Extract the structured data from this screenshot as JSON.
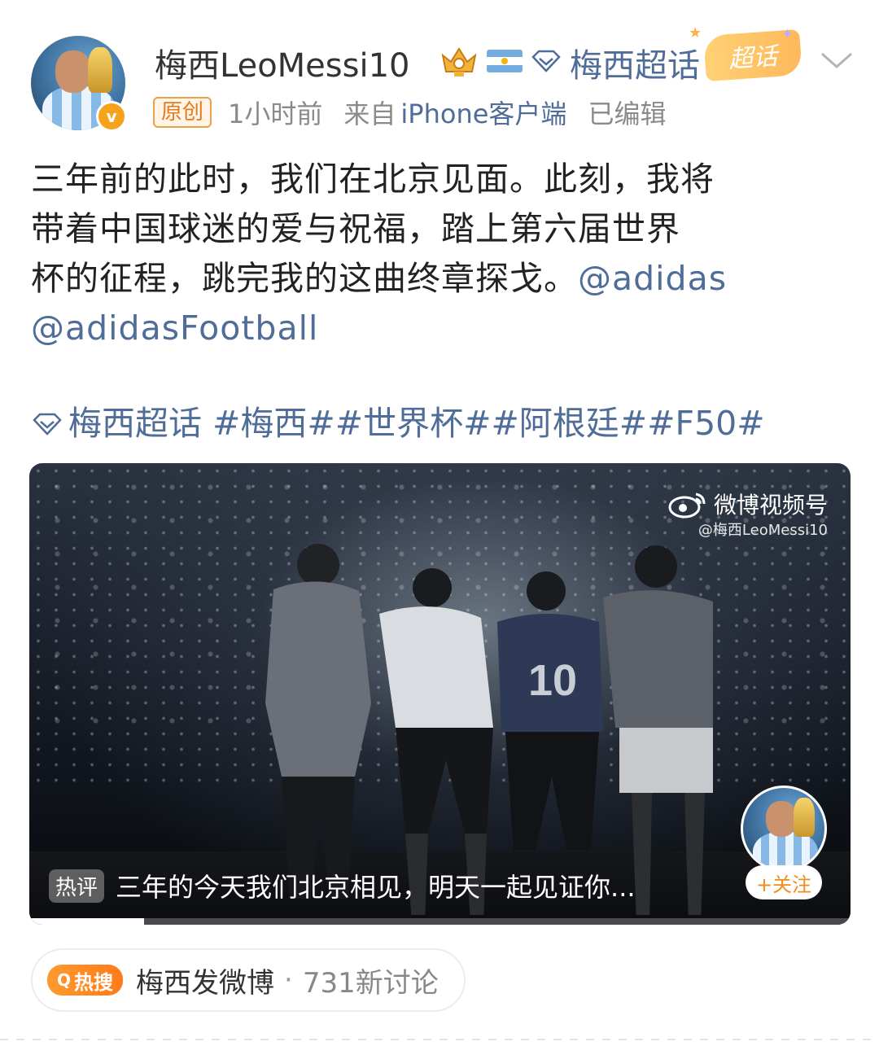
{
  "header": {
    "username": "梅西LeoMessi10",
    "supertopic_link": "梅西超话",
    "supertopic_tag": "超话",
    "verified_badge": "v"
  },
  "meta": {
    "original_badge": "原创",
    "time": "1小时前",
    "from_label": "来自",
    "client": "iPhone客户端",
    "edited": "已编辑"
  },
  "post": {
    "lines": [
      "三年前的此时，我们在北京见面。此刻，我将",
      "带着中国球迷的爱与祝福，踏上第六届世界",
      "杯的征程，跳完我的这曲终章探戈。"
    ],
    "mention_1": "@adidas",
    "mention_2": "@adidasFootball",
    "topics": "梅西超话 #梅西##世界杯##阿根廷##F50#"
  },
  "video": {
    "watermark_brand": "微博视频号",
    "watermark_handle": "@梅西LeoMessi10",
    "follow_label": "+关注",
    "hot_comment_label": "热评",
    "hot_comment_text": "三年的今天我们北京相见，明天一起见证你...",
    "progress": 0.14
  },
  "hot_search": {
    "badge": "热搜",
    "topic": "梅西发微博",
    "separator": "·",
    "count": "731新讨论"
  },
  "icons": {
    "avatar": "avatar-photo",
    "crown": "crown-icon",
    "flag": "argentina-flag-icon",
    "diamond": "diamond-icon",
    "chevron": "chevron-down-icon",
    "weibo": "weibo-logo-icon"
  },
  "colors": {
    "link": "#4f6d98",
    "accent": "#f7a21b"
  }
}
